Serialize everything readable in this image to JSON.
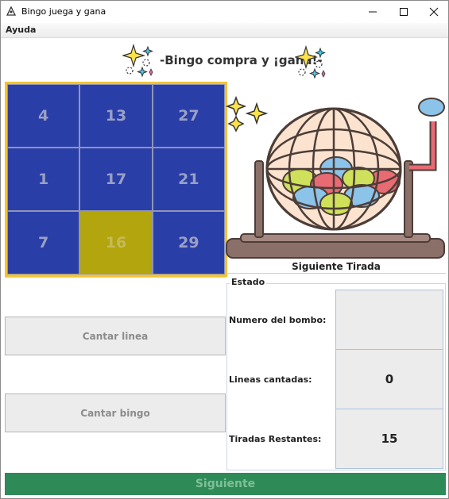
{
  "window": {
    "title": "Bingo juega y gana",
    "minimize_glyph": "—",
    "maximize_glyph": "☐",
    "close_glyph": "✕"
  },
  "menu": {
    "ayuda_label": "Ayuda"
  },
  "header": {
    "title": "-Bingo compra y ¡gana!-"
  },
  "board": {
    "frame_color": "#f4c430",
    "cell_color": "#2a3ea8",
    "marked_color": "#b3a50d",
    "cells": [
      {
        "number": "4",
        "marked": false
      },
      {
        "number": "13",
        "marked": false
      },
      {
        "number": "27",
        "marked": false
      },
      {
        "number": "1",
        "marked": false
      },
      {
        "number": "17",
        "marked": false
      },
      {
        "number": "21",
        "marked": false
      },
      {
        "number": "7",
        "marked": false
      },
      {
        "number": "16",
        "marked": true
      },
      {
        "number": "29",
        "marked": false
      }
    ]
  },
  "machine": {
    "label": "Siguiente Tirada"
  },
  "buttons": {
    "cantar_linea": "Cantar linea",
    "cantar_bingo": "Cantar bingo",
    "siguiente": "Siguiente"
  },
  "estado": {
    "legend": "Estado",
    "numero_label": "Numero del bombo:",
    "numero_value": "",
    "lineas_label": "Lineas cantadas:",
    "lineas_value": "0",
    "tiradas_label": "Tiradas Restantes:",
    "tiradas_value": "15"
  },
  "colors": {
    "accent_green": "#2e8b57"
  }
}
